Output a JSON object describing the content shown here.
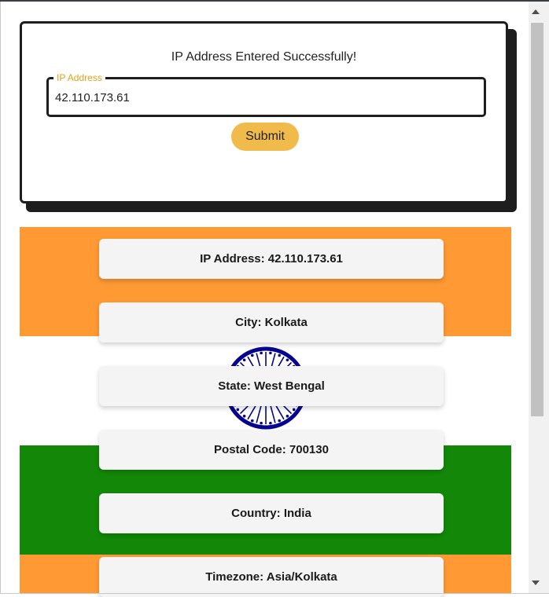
{
  "form": {
    "success_message": "IP Address Entered Successfully!",
    "ip_field_legend": "IP Address",
    "ip_field_value": "42.110.173.61",
    "submit_label": "Submit"
  },
  "results": {
    "ip": "IP Address: 42.110.173.61",
    "city": "City: Kolkata",
    "state": "State: West Bengal",
    "postal": "Postal Code: 700130",
    "country": "Country: India",
    "timezone": "Timezone: Asia/Kolkata"
  },
  "colors": {
    "accent": "#f1bb4b",
    "legend": "#e0a21a",
    "flag_saffron": "#ff9933",
    "flag_white": "#ffffff",
    "flag_green": "#138808",
    "chakra_blue": "#06038d"
  },
  "icons": {
    "chakra": "ashoka-chakra-icon"
  }
}
